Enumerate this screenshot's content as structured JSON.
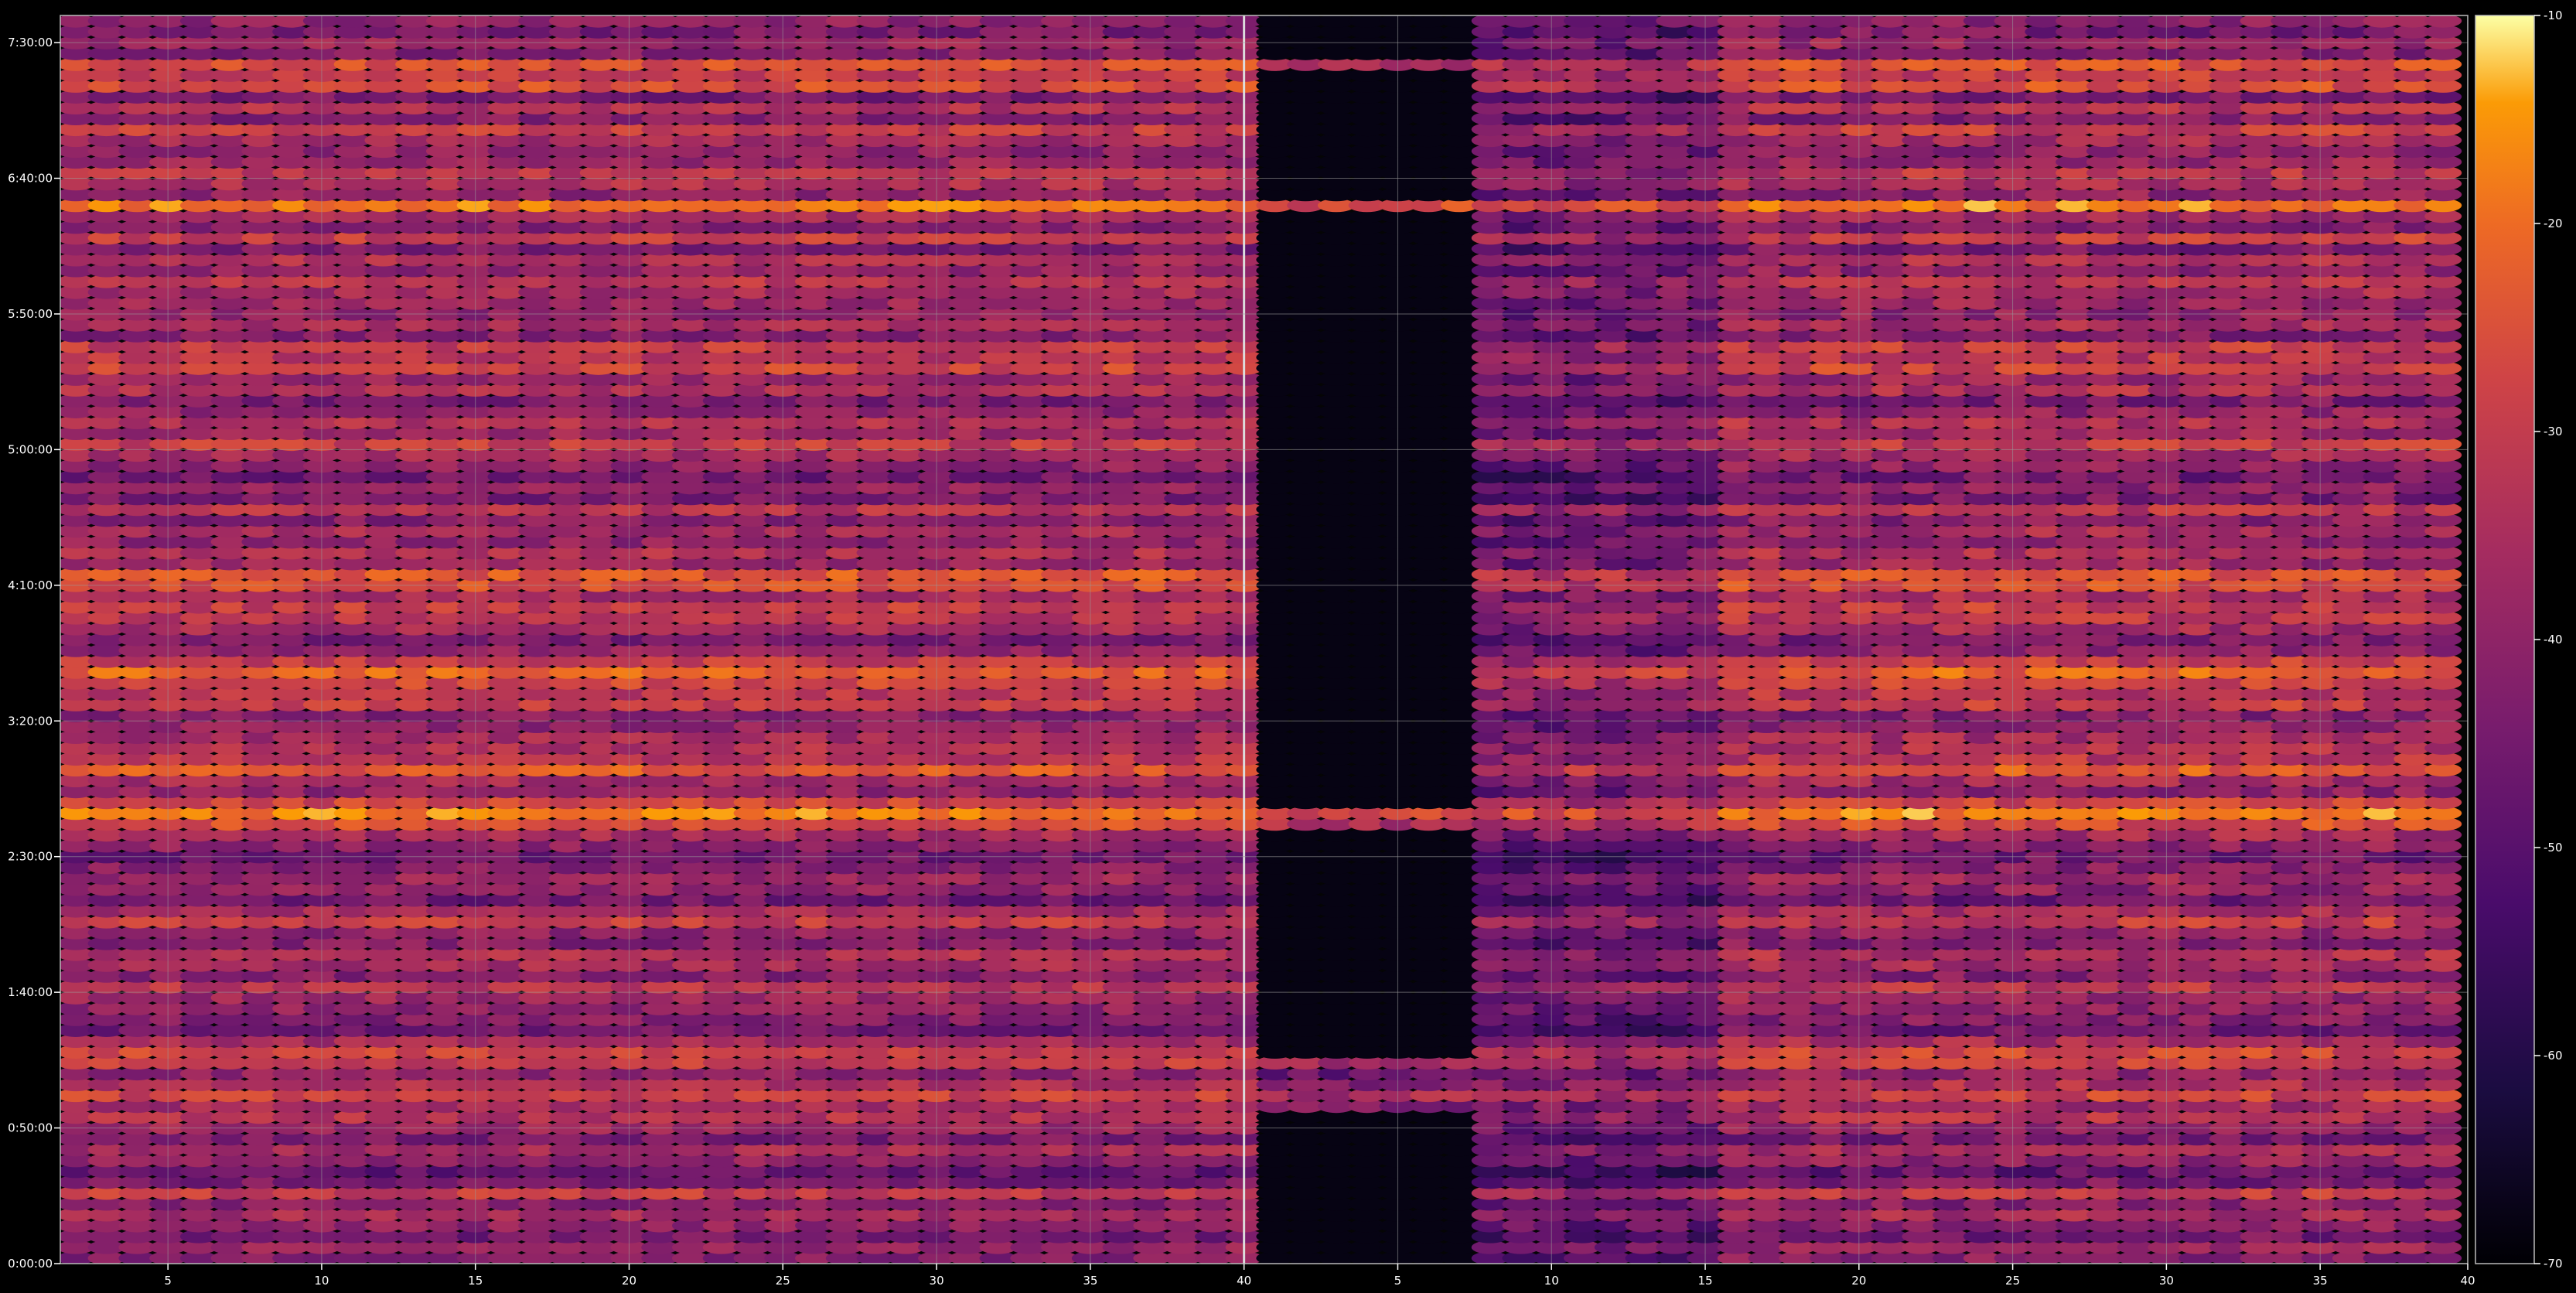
{
  "chart_data": {
    "type": "heatmap",
    "title": "",
    "xlabel": "",
    "ylabel": "",
    "panels": [
      {
        "name": "",
        "xlim": [
          1.5,
          40
        ],
        "active_from": 1.5
      },
      {
        "name": "",
        "xlim": [
          40,
          79.8
        ],
        "active_from": 48,
        "note_hidden": ""
      }
    ],
    "x_ticks": [
      5,
      10,
      15,
      20,
      25,
      30,
      35,
      40,
      45,
      50,
      55,
      60,
      65,
      70,
      75,
      80
    ],
    "x_tick_labels": [
      "5",
      "10",
      "15",
      "20",
      "25",
      "30",
      "35",
      "40",
      "5",
      "10",
      "15",
      "20",
      "25",
      "30",
      "35",
      "40"
    ],
    "y_range_minutes": [
      0,
      460
    ],
    "y_ticks_minutes": [
      0,
      50,
      100,
      150,
      200,
      250,
      300,
      350,
      400,
      450
    ],
    "y_tick_labels": [
      "0:00:00",
      "0:50:00",
      "1:40:00",
      "2:30:00",
      "3:20:00",
      "4:10:00",
      "5:00:00",
      "5:50:00",
      "6:40:00",
      "7:30:00"
    ],
    "colorbar": {
      "min": -70,
      "max": -10,
      "ticks": [
        -10,
        -20,
        -30,
        -40,
        -50,
        -60,
        -70
      ],
      "tick_labels": [
        "-10",
        "-20",
        "-30",
        "-40",
        "-50",
        "-60",
        "-70"
      ],
      "colormap": "inferno"
    },
    "rows_minutes": [
      2,
      6,
      10,
      14,
      18,
      22,
      26,
      30,
      34,
      38,
      42,
      46,
      50,
      54,
      58,
      62,
      66,
      70,
      74,
      78,
      82,
      86,
      90,
      94,
      98,
      102,
      106,
      110,
      114,
      118,
      122,
      126,
      130,
      134,
      138,
      142,
      146,
      150,
      154,
      158,
      162,
      166,
      170,
      174,
      178,
      182,
      186,
      190,
      194,
      198,
      202,
      206,
      210,
      214,
      218,
      222,
      226,
      230,
      234,
      238,
      242,
      246,
      250,
      254,
      258,
      262,
      266,
      270,
      274,
      278,
      282,
      286,
      290,
      294,
      298,
      302,
      306,
      310,
      314,
      318,
      322,
      326,
      330,
      334,
      338,
      342,
      346,
      350,
      354,
      358,
      362,
      366,
      370,
      374,
      378,
      382,
      386,
      390,
      394,
      398,
      402,
      406,
      410,
      414,
      418,
      422,
      426,
      430,
      434,
      438,
      442,
      446,
      450,
      454,
      458
    ],
    "row_levels_dB": [
      -42,
      -38,
      -45,
      -40,
      -36,
      -42,
      -30,
      -44,
      -48,
      -40,
      -36,
      -44,
      -38,
      -33,
      -36,
      -28,
      -34,
      -40,
      -30,
      -28,
      -36,
      -46,
      -42,
      -40,
      -38,
      -32,
      -42,
      -36,
      -34,
      -42,
      -40,
      -30,
      -36,
      -46,
      -40,
      -38,
      -42,
      -46,
      -40,
      -36,
      -26,
      -18,
      -28,
      -40,
      -36,
      -24,
      -32,
      -34,
      -36,
      -40,
      -42,
      -30,
      -32,
      -28,
      -22,
      -30,
      -40,
      -44,
      -36,
      -32,
      -30,
      -36,
      -26,
      -24,
      -38,
      -34,
      -40,
      -36,
      -42,
      -32,
      -44,
      -40,
      -46,
      -40,
      -36,
      -30,
      -38,
      -34,
      -40,
      -44,
      -34,
      -38,
      -28,
      -32,
      -30,
      -42,
      -36,
      -40,
      -38,
      -36,
      -32,
      -40,
      -34,
      -44,
      -30,
      -42,
      -36,
      -18,
      -40,
      -34,
      -32,
      -38,
      -40,
      -36,
      -30,
      -42,
      -34,
      -44,
      -26,
      -30,
      -26,
      -42,
      -38,
      -44,
      -40
    ],
    "row_left_tails": [
      0,
      0,
      0,
      0,
      0,
      0,
      0,
      0,
      0,
      0,
      0,
      0,
      0,
      0,
      1,
      1,
      1,
      1,
      1,
      0,
      0,
      0,
      0,
      0,
      0,
      0,
      0,
      0,
      0,
      0,
      0,
      0,
      0,
      0,
      0,
      0,
      0,
      0,
      0,
      0,
      1,
      1,
      0,
      0,
      0,
      0,
      0,
      0,
      0,
      0,
      0,
      0,
      0,
      0,
      0,
      0,
      0,
      0,
      0,
      0,
      0,
      0,
      0,
      0,
      0,
      0,
      0,
      0,
      0,
      0,
      0,
      0,
      0,
      0,
      0,
      0,
      0,
      0,
      0,
      0,
      0,
      0,
      0,
      0,
      0,
      0,
      0,
      0,
      0,
      0,
      0,
      0,
      0,
      0,
      0,
      0,
      0,
      1,
      0,
      0,
      0,
      0,
      0,
      0,
      0,
      0,
      0,
      0,
      0,
      0,
      1,
      0,
      0,
      0,
      0
    ]
  }
}
